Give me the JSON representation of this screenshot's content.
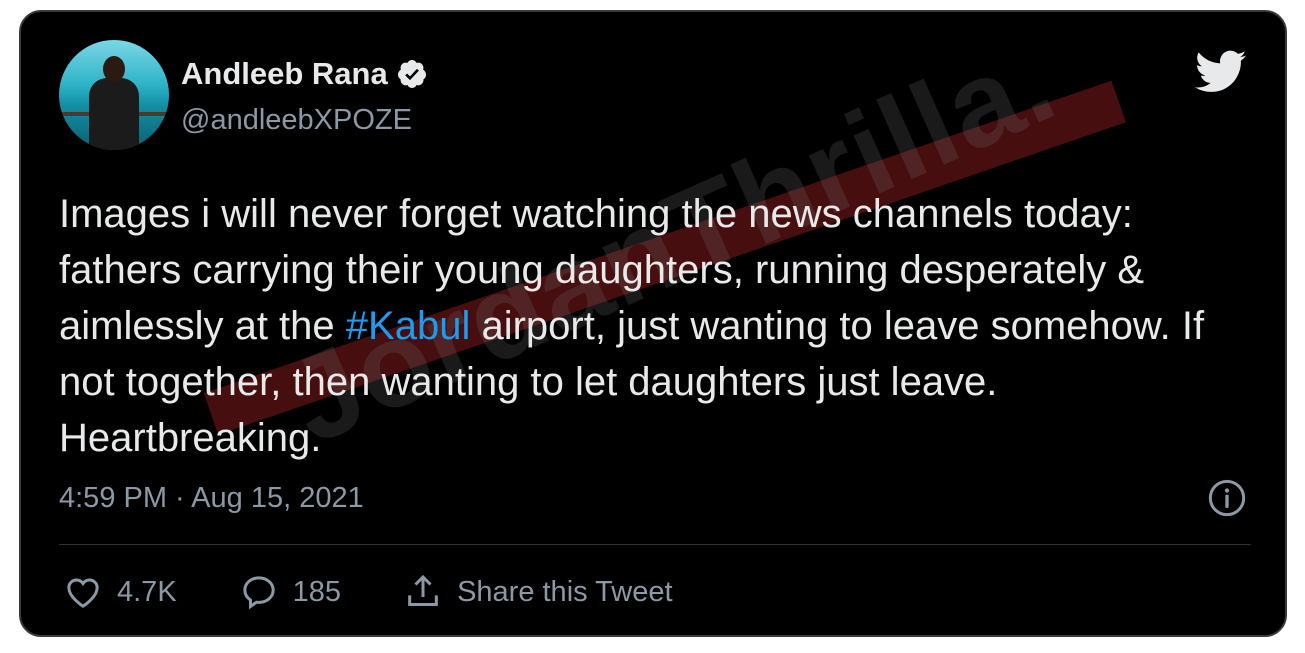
{
  "author": {
    "name": "Andleeb Rana",
    "handle": "@andleebXPOZE",
    "verified": true
  },
  "tweet": {
    "text_before": "Images i will never forget watching the news channels today: fathers carrying their young daughters, running desperately & aimlessly at the ",
    "hashtag": "#Kabul",
    "text_after": " airport, just wanting to leave somehow. If not together, then wanting to let daughters just leave. Heartbreaking.",
    "timestamp": "4:59 PM · Aug 15, 2021"
  },
  "actions": {
    "likes": "4.7K",
    "replies": "185",
    "share_label": "Share this Tweet"
  },
  "watermark": "JordanThrilla.",
  "colors": {
    "background": "#000000",
    "text": "#e7e9ea",
    "secondary": "#8b98a5",
    "link": "#1d9bf0"
  },
  "icons": [
    "verified-badge-icon",
    "twitter-bird-icon",
    "info-icon",
    "heart-icon",
    "reply-icon",
    "share-icon"
  ]
}
